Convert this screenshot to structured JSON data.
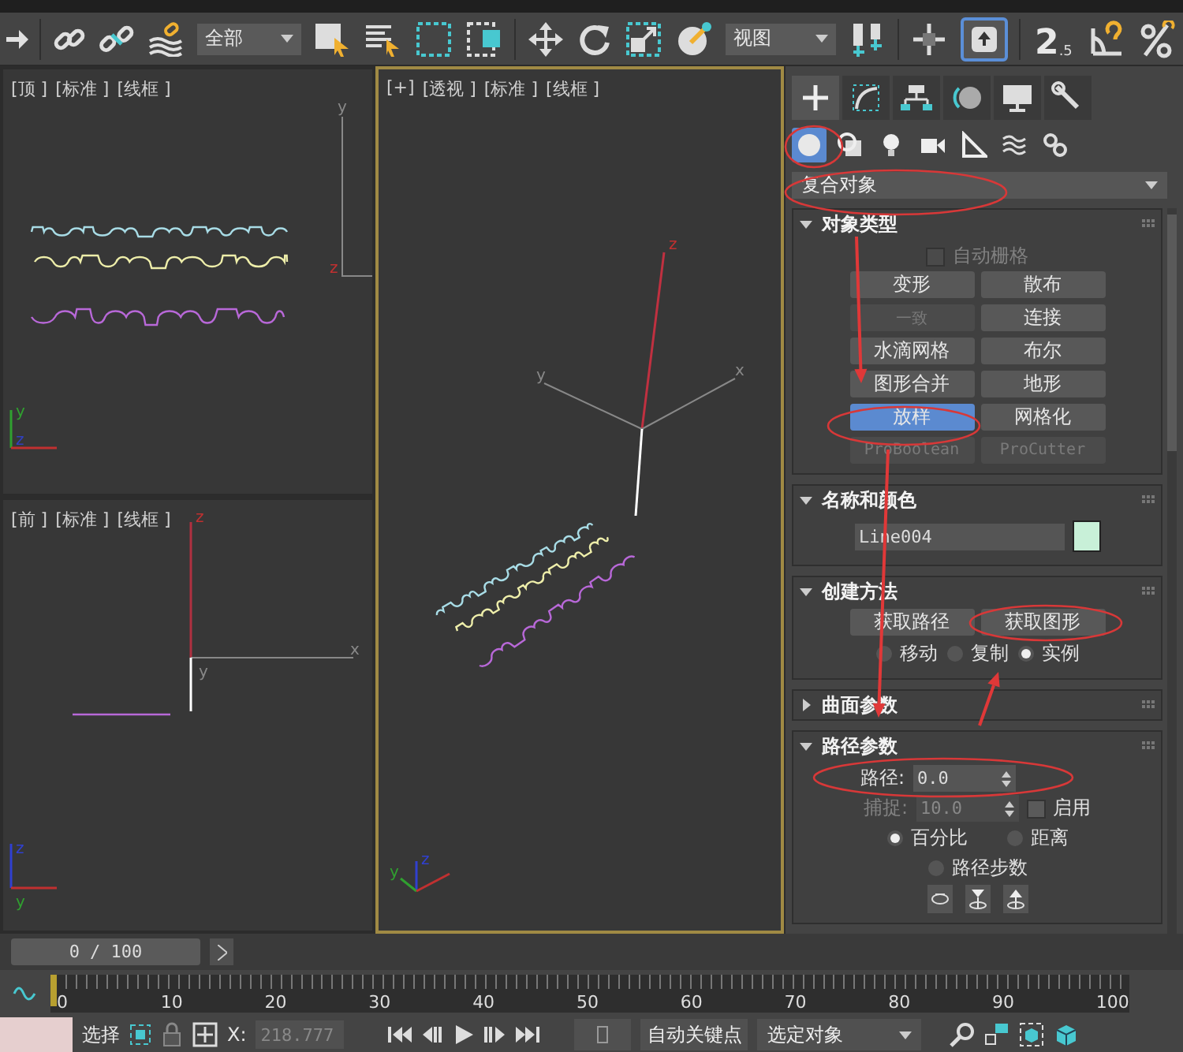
{
  "toolbar": {
    "selection_filter": "全部",
    "reference_coordinate": "视图",
    "snap_toggle": {
      "digit": "2",
      "sub": ".5"
    },
    "keyboard_shortcut_override": {
      "on": true
    }
  },
  "scene_shapes": [
    {
      "color": "#a8dce6"
    },
    {
      "color": "#eeeeaa"
    },
    {
      "color": "#b868d8"
    }
  ],
  "viewports": [
    {
      "kind": "top",
      "active": false,
      "labels": [
        "[顶 ]",
        "[标准 ]",
        "[线框 ]"
      ],
      "grid_axis_labels": [
        "y",
        "z"
      ],
      "gizmo_axis_labels": [
        "y",
        "z"
      ]
    },
    {
      "kind": "front",
      "active": false,
      "labels": [
        "[前 ]",
        "[标准 ]",
        "[线框 ]"
      ],
      "grid_axis_labels": [
        "z",
        "y",
        "x"
      ],
      "gizmo_axis_labels": [
        "z",
        "y"
      ]
    },
    {
      "kind": "perspective",
      "active": true,
      "labels": [
        "[+]",
        "[透视 ]",
        "[标准 ]",
        "[线框 ]"
      ],
      "grid_axis_labels": [
        "z",
        "y",
        "x"
      ],
      "gizmo_axis_labels": [
        "z",
        "y"
      ]
    }
  ],
  "command_panel": {
    "tabs": [
      {
        "selected": true
      },
      {
        "selected": false
      },
      {
        "selected": false
      },
      {
        "selected": false
      },
      {
        "selected": false
      },
      {
        "selected": false
      }
    ],
    "categories": [
      {
        "selected": true
      },
      {
        "selected": false
      },
      {
        "selected": false
      },
      {
        "selected": false
      },
      {
        "selected": false
      },
      {
        "selected": false
      },
      {
        "selected": false
      }
    ],
    "dropdown": "复合对象",
    "rollouts": [
      {
        "kind": "object_type",
        "title": "对象类型",
        "expanded": true,
        "checkbox": {
          "label": "自动栅格",
          "checked": false,
          "disabled": true
        },
        "buttons": [
          {
            "label": "变形",
            "selected": false,
            "disabled": false
          },
          {
            "label": "散布",
            "selected": false,
            "disabled": false
          },
          {
            "label": "一致",
            "selected": false,
            "disabled": true
          },
          {
            "label": "连接",
            "selected": false,
            "disabled": false
          },
          {
            "label": "水滴网格",
            "selected": false,
            "disabled": false
          },
          {
            "label": "布尔",
            "selected": false,
            "disabled": false
          },
          {
            "label": "图形合并",
            "selected": false,
            "disabled": false
          },
          {
            "label": "地形",
            "selected": false,
            "disabled": false
          },
          {
            "label": "放样",
            "selected": true,
            "disabled": false
          },
          {
            "label": "网格化",
            "selected": false,
            "disabled": false
          },
          {
            "label": "ProBoolean",
            "selected": false,
            "disabled": true
          },
          {
            "label": "ProCutter",
            "selected": false,
            "disabled": true
          }
        ]
      },
      {
        "kind": "name_color",
        "title": "名称和颜色",
        "expanded": true,
        "name": "Line004",
        "color": "#c8f0d8"
      },
      {
        "kind": "creation",
        "title": "创建方法",
        "expanded": true,
        "buttons": [
          "获取路径",
          "获取图形"
        ],
        "radios": [
          {
            "label": "移动",
            "selected": false
          },
          {
            "label": "复制",
            "selected": false
          },
          {
            "label": "实例",
            "selected": true
          }
        ]
      },
      {
        "kind": "surface",
        "title": "曲面参数",
        "expanded": false
      },
      {
        "kind": "path_params",
        "title": "路径参数",
        "expanded": true,
        "path": {
          "label": "路径:",
          "value": "0.0"
        },
        "snap": {
          "label": "捕捉:",
          "value": "10.0",
          "disabled": true
        },
        "enable": {
          "label": "启用",
          "checked": false
        },
        "radios": [
          {
            "label": "百分比",
            "selected": true
          },
          {
            "label": "距离",
            "selected": false
          },
          {
            "label": "路径步数",
            "selected": false
          }
        ]
      }
    ]
  },
  "time_slider": {
    "label": "0 / 100",
    "level": 0
  },
  "track_bar": {
    "ticks": [
      "0",
      "10",
      "20",
      "30",
      "40",
      "50",
      "60",
      "70",
      "80",
      "90",
      "100"
    ]
  },
  "status_bar": {
    "prompt": "选择",
    "x_label": "X:",
    "x_value": "218.777",
    "auto_key": {
      "label": "自动关键点",
      "on": false
    },
    "key_filter": "选定对象"
  },
  "annotations": [
    {
      "kind": "ellipse"
    },
    {
      "kind": "ellipse"
    },
    {
      "kind": "ellipse"
    },
    {
      "kind": "ellipse"
    },
    {
      "kind": "ellipse"
    },
    {
      "kind": "arrow"
    },
    {
      "kind": "arrow"
    },
    {
      "kind": "arrow"
    }
  ]
}
